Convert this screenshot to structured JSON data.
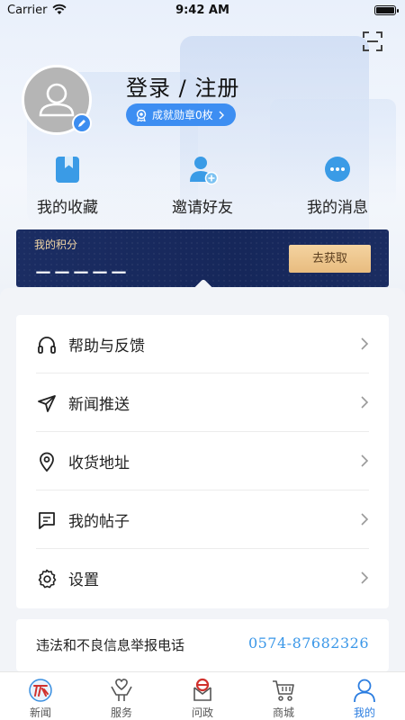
{
  "status_bar": {
    "carrier": "Carrier",
    "time": "9:42 AM"
  },
  "profile": {
    "login_text": "登录 / 注册",
    "medal_text": "成就勋章0枚"
  },
  "quick_actions": [
    {
      "label": "我的收藏",
      "icon": "bookmark-icon"
    },
    {
      "label": "邀请好友",
      "icon": "invite-user-icon"
    },
    {
      "label": "我的消息",
      "icon": "message-icon"
    }
  ],
  "points": {
    "label": "我的积分",
    "value": "－－－－－",
    "button": "去获取"
  },
  "menu": [
    {
      "label": "帮助与反馈",
      "icon": "headphones-icon"
    },
    {
      "label": "新闻推送",
      "icon": "send-icon"
    },
    {
      "label": "收货地址",
      "icon": "location-pin-icon"
    },
    {
      "label": "我的帖子",
      "icon": "post-icon"
    },
    {
      "label": "设置",
      "icon": "gear-icon"
    }
  ],
  "report": {
    "label": "违法和不良信息举报电话",
    "phone": "0574-87682326"
  },
  "tabs": [
    {
      "label": "新闻",
      "icon": "news-logo-icon"
    },
    {
      "label": "服务",
      "icon": "service-icon"
    },
    {
      "label": "问政",
      "icon": "wenzheng-icon"
    },
    {
      "label": "商城",
      "icon": "cart-icon"
    },
    {
      "label": "我的",
      "icon": "profile-icon",
      "active": true
    }
  ],
  "colors": {
    "accent": "#3d8ef2",
    "points_bg": "#1b2d63",
    "gold": "#e8bc7f",
    "phone": "#3a97e8"
  }
}
